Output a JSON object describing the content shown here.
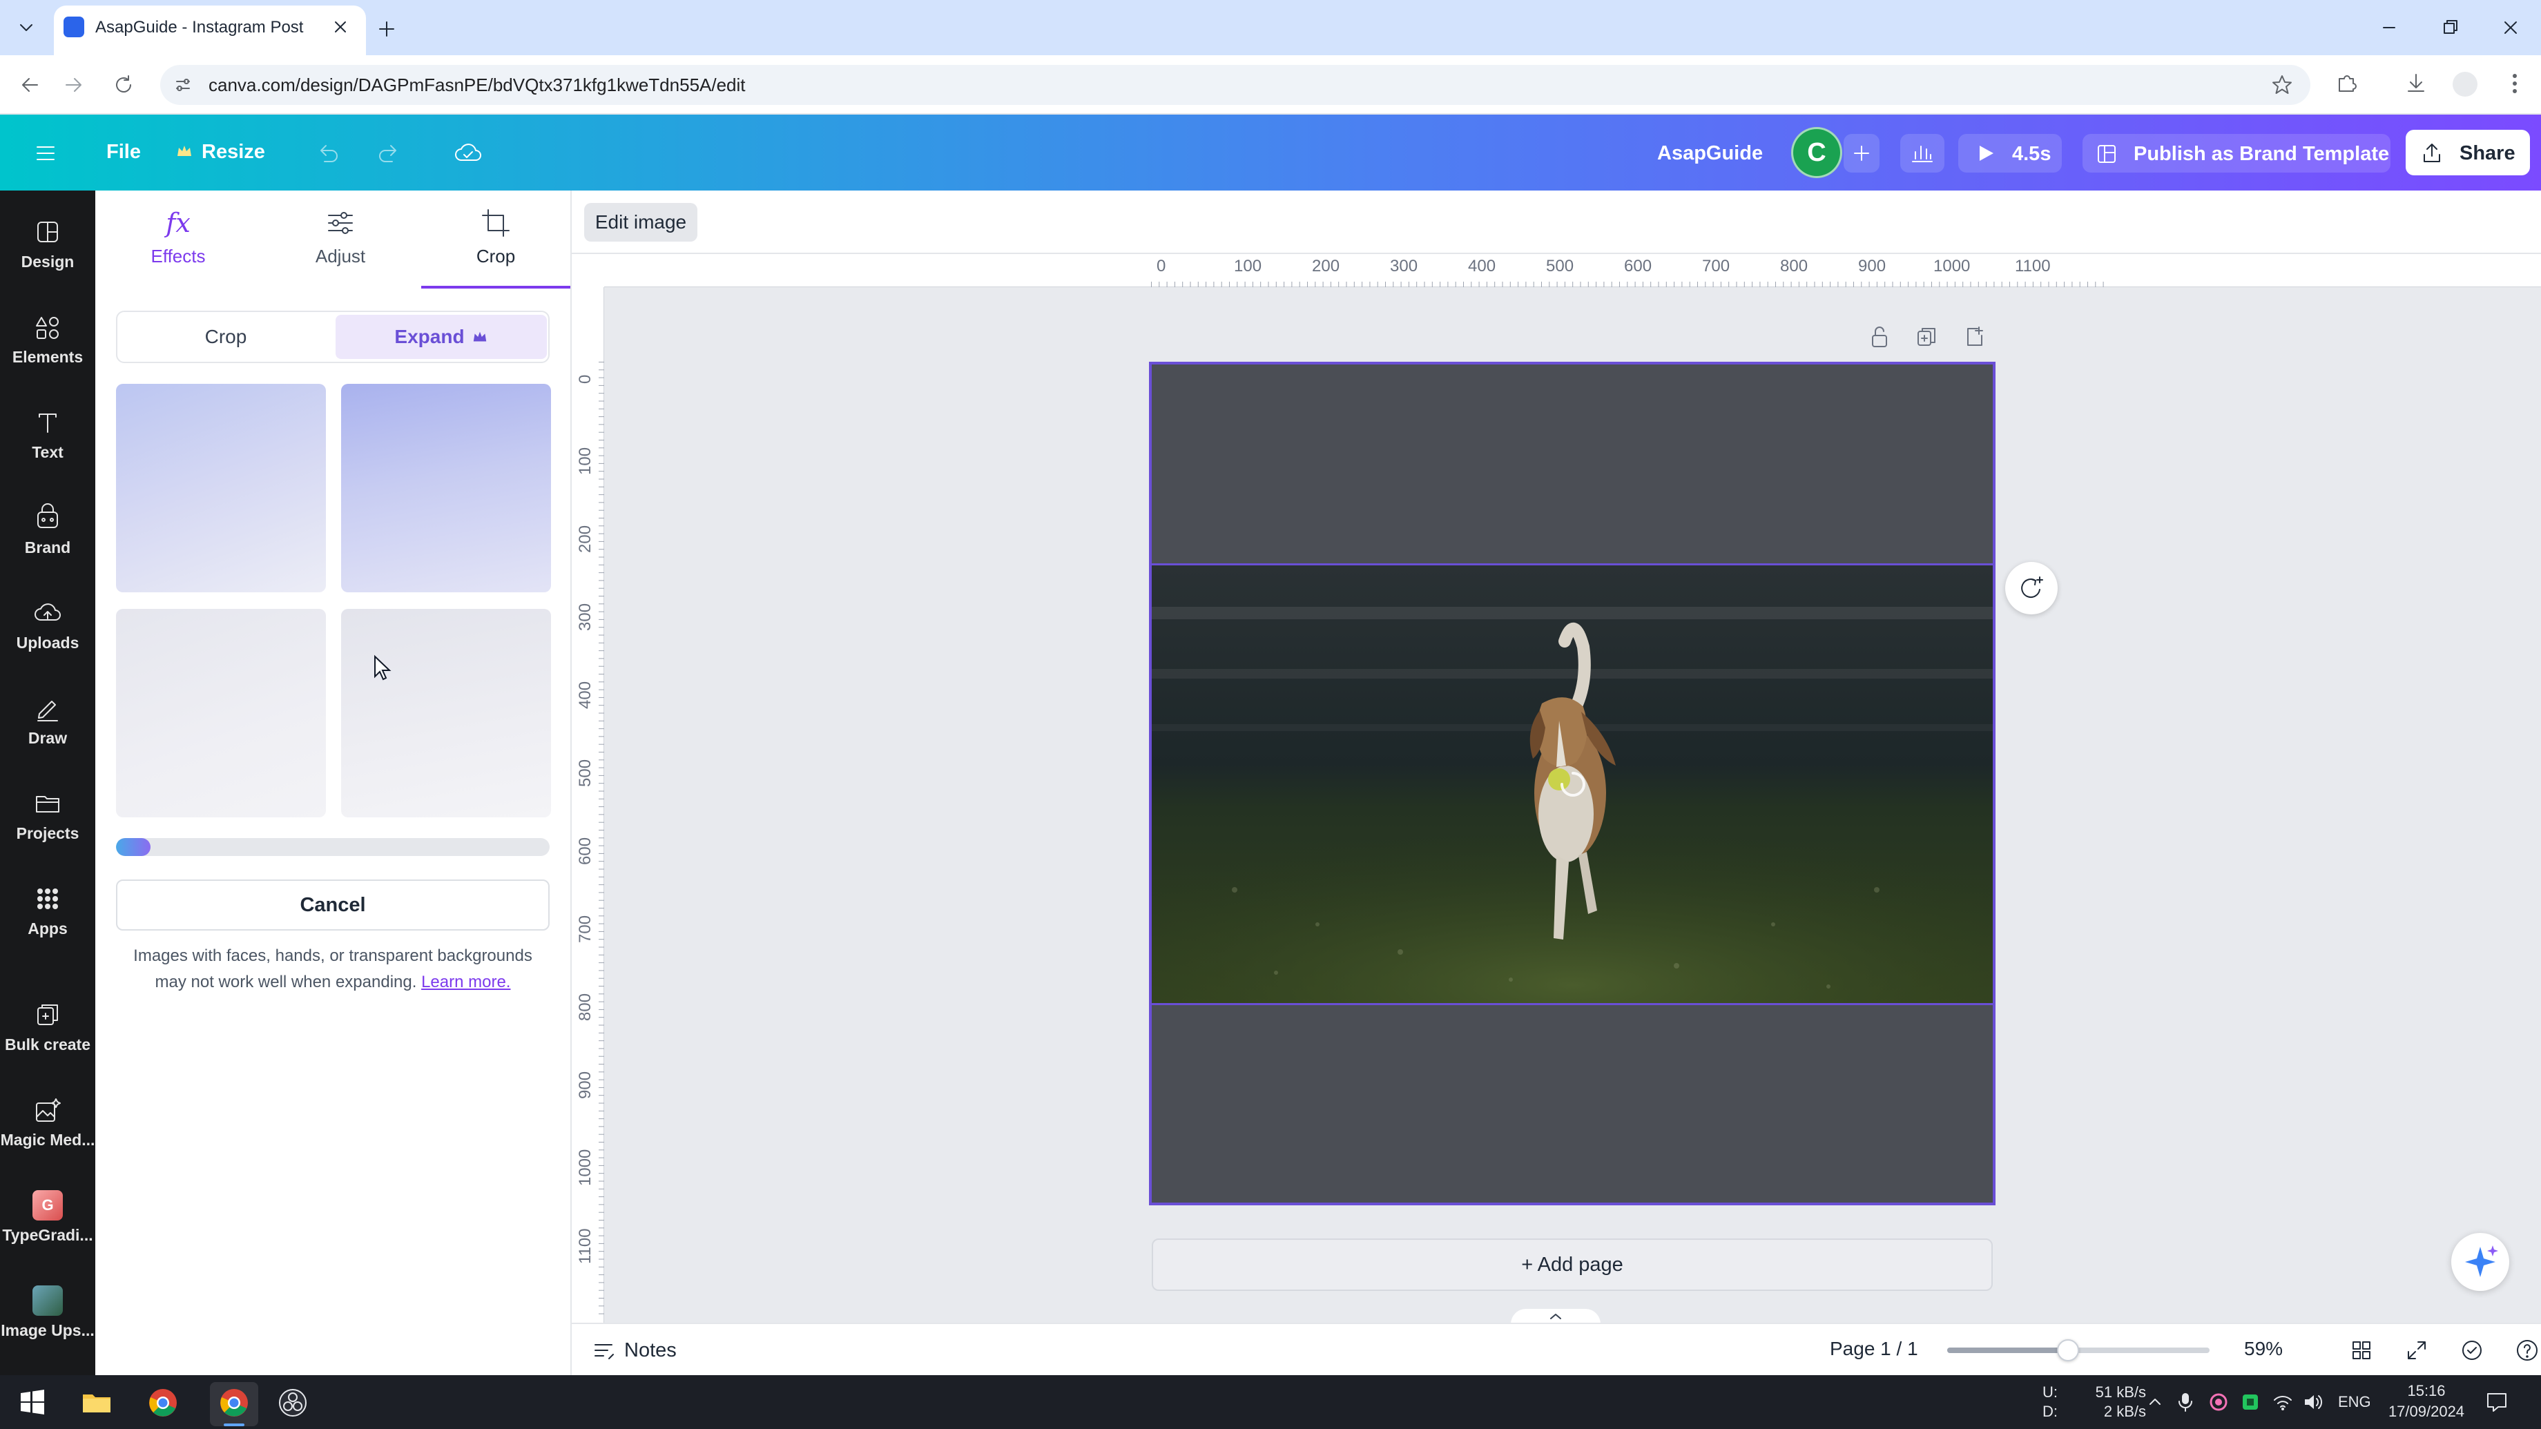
{
  "browser": {
    "tab_title": "AsapGuide - Instagram Post",
    "url": "canva.com/design/DAGPmFasnPE/bdVQtx371kfg1kweTdn55A/edit"
  },
  "header": {
    "file_label": "File",
    "resize_label": "Resize",
    "team_name": "AsapGuide",
    "avatar_initial": "C",
    "present_duration": "4.5s",
    "publish_label": "Publish as Brand Template",
    "share_label": "Share"
  },
  "rail": [
    {
      "label": "Design",
      "icon": "design-icon"
    },
    {
      "label": "Elements",
      "icon": "elements-icon"
    },
    {
      "label": "Text",
      "icon": "text-icon"
    },
    {
      "label": "Brand",
      "icon": "brand-icon"
    },
    {
      "label": "Uploads",
      "icon": "uploads-icon"
    },
    {
      "label": "Draw",
      "icon": "draw-icon"
    },
    {
      "label": "Projects",
      "icon": "projects-icon"
    },
    {
      "label": "Apps",
      "icon": "apps-icon"
    },
    {
      "label": "Bulk create",
      "icon": "bulk-create-icon"
    },
    {
      "label": "Magic Med...",
      "icon": "magic-media-icon"
    },
    {
      "label": "TypeGradi...",
      "icon": "typegradient-app-icon"
    },
    {
      "label": "Image Ups...",
      "icon": "image-upscaler-app-icon"
    }
  ],
  "panel": {
    "tabs": [
      {
        "label": "Effects",
        "icon": "fx-icon"
      },
      {
        "label": "Adjust",
        "icon": "sliders-icon"
      },
      {
        "label": "Crop",
        "icon": "crop-icon"
      }
    ],
    "active_tab": "Crop",
    "segment": {
      "crop": "Crop",
      "expand": "Expand"
    },
    "progress": 0.08,
    "cancel_label": "Cancel",
    "note_text": "Images with faces, hands, or transparent backgrounds may not work well when expanding.",
    "note_link": "Learn more."
  },
  "toolbar": {
    "edit_image_label": "Edit image"
  },
  "ruler": {
    "top_ticks": [
      "0",
      "100",
      "200",
      "300",
      "400",
      "500",
      "600",
      "700",
      "800",
      "900",
      "1000",
      "1100"
    ],
    "left_ticks": [
      "0",
      "100",
      "200",
      "300",
      "400",
      "500",
      "600",
      "700",
      "800",
      "900",
      "1000",
      "1100"
    ]
  },
  "canvas": {
    "add_page_label": "+ Add page"
  },
  "bottombar": {
    "notes_label": "Notes",
    "page_indicator": "Page 1 / 1",
    "zoom": "59%",
    "zoom_fraction": 0.46
  },
  "taskbar": {
    "net_up_label": "U:",
    "net_down_label": "D:",
    "net_up": "51 kB/s",
    "net_down": "2 kB/s",
    "language": "ENG",
    "time": "15:16",
    "date": "17/09/2024"
  },
  "colors": {
    "accent": "#6a4fd6",
    "expand_bg": "#ede7fb",
    "rail_bg": "#18191b"
  }
}
